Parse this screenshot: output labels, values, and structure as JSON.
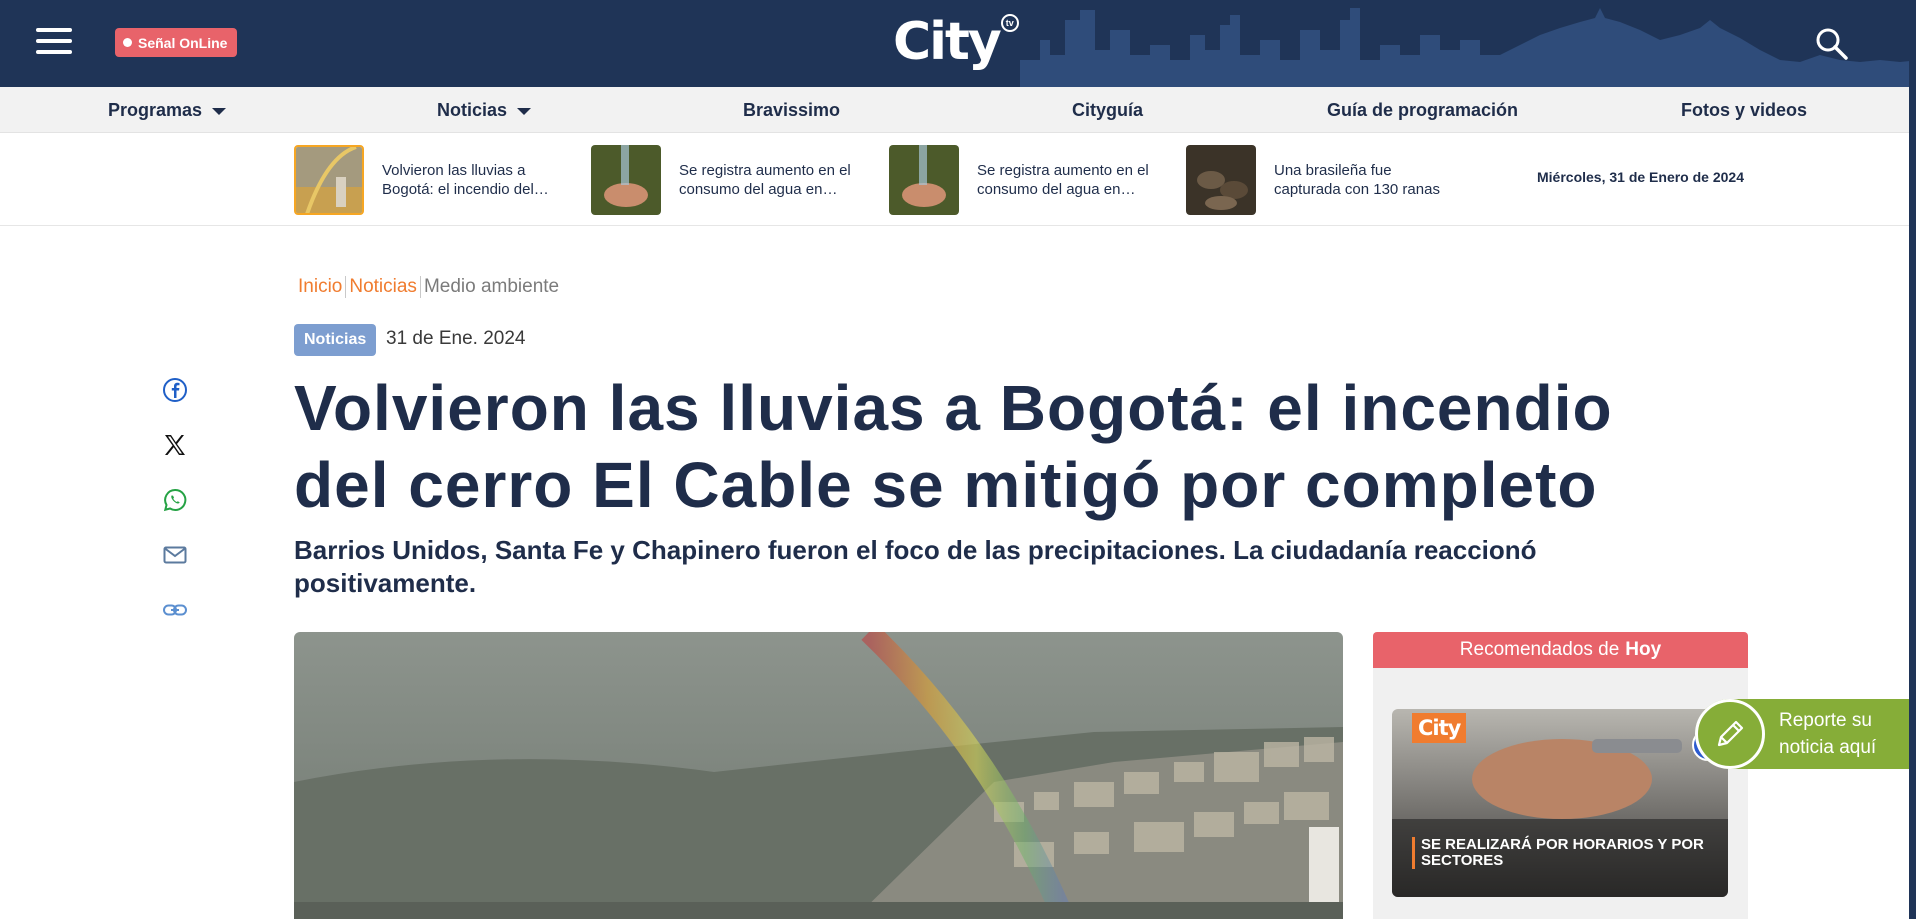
{
  "header": {
    "live_label": "Señal OnLine",
    "logo_text": "City",
    "logo_badge": "tv",
    "menu_icon": "hamburger-menu-icon",
    "search_icon": "search-icon",
    "background_color": "#1f3457"
  },
  "nav": {
    "items": [
      {
        "label": "Programas",
        "has_dropdown": true
      },
      {
        "label": "Noticias",
        "has_dropdown": true
      },
      {
        "label": "Bravissimo",
        "has_dropdown": false
      },
      {
        "label": "Cityguía",
        "has_dropdown": false
      },
      {
        "label": "Guía de programación",
        "has_dropdown": false
      },
      {
        "label": "Fotos y videos",
        "has_dropdown": false
      }
    ]
  },
  "ticker": {
    "items": [
      {
        "text": "Volvieron las lluvias a Bogotá: el incendio del cerro El Cable se mitigó por completo",
        "selected": true
      },
      {
        "text": "Se registra aumento en el consumo del agua en Bogotá",
        "selected": false
      },
      {
        "text": "Se registra aumento en el consumo del agua en Bogotá",
        "selected": false
      },
      {
        "text": "Una brasileña fue capturada con 130 ranas",
        "selected": false
      }
    ],
    "date": "Miércoles, 31 de Enero de 2024"
  },
  "breadcrumb": {
    "items": [
      "Inicio",
      "Noticias"
    ],
    "current": "Medio ambiente"
  },
  "article": {
    "category": "Noticias",
    "date": "31 de Ene. 2024",
    "title": "Volvieron las lluvias a Bogotá: el incendio del cerro El Cable se mitigó por completo",
    "subtitle": "Barrios Unidos, Santa Fe y Chapinero fueron el foco de las precipitaciones. La ciudadanía reaccionó positivamente."
  },
  "share": {
    "icons": [
      "facebook-icon",
      "x-icon",
      "whatsapp-icon",
      "email-icon",
      "link-icon"
    ]
  },
  "recommended": {
    "heading_prefix": "Recomendados de",
    "heading_emphasis": "Hoy",
    "card": {
      "logo": "City",
      "caption": "Se realizará por horarios y por sectores"
    }
  },
  "report": {
    "label": "Reporte su noticia aquí",
    "icon": "pencil-icon"
  },
  "colors": {
    "accent_orange": "#f07c2f",
    "live_red": "#e8636a",
    "category_blue": "#7d9ed0",
    "report_green": "#86ad38",
    "text_navy": "#1f2d4a"
  }
}
